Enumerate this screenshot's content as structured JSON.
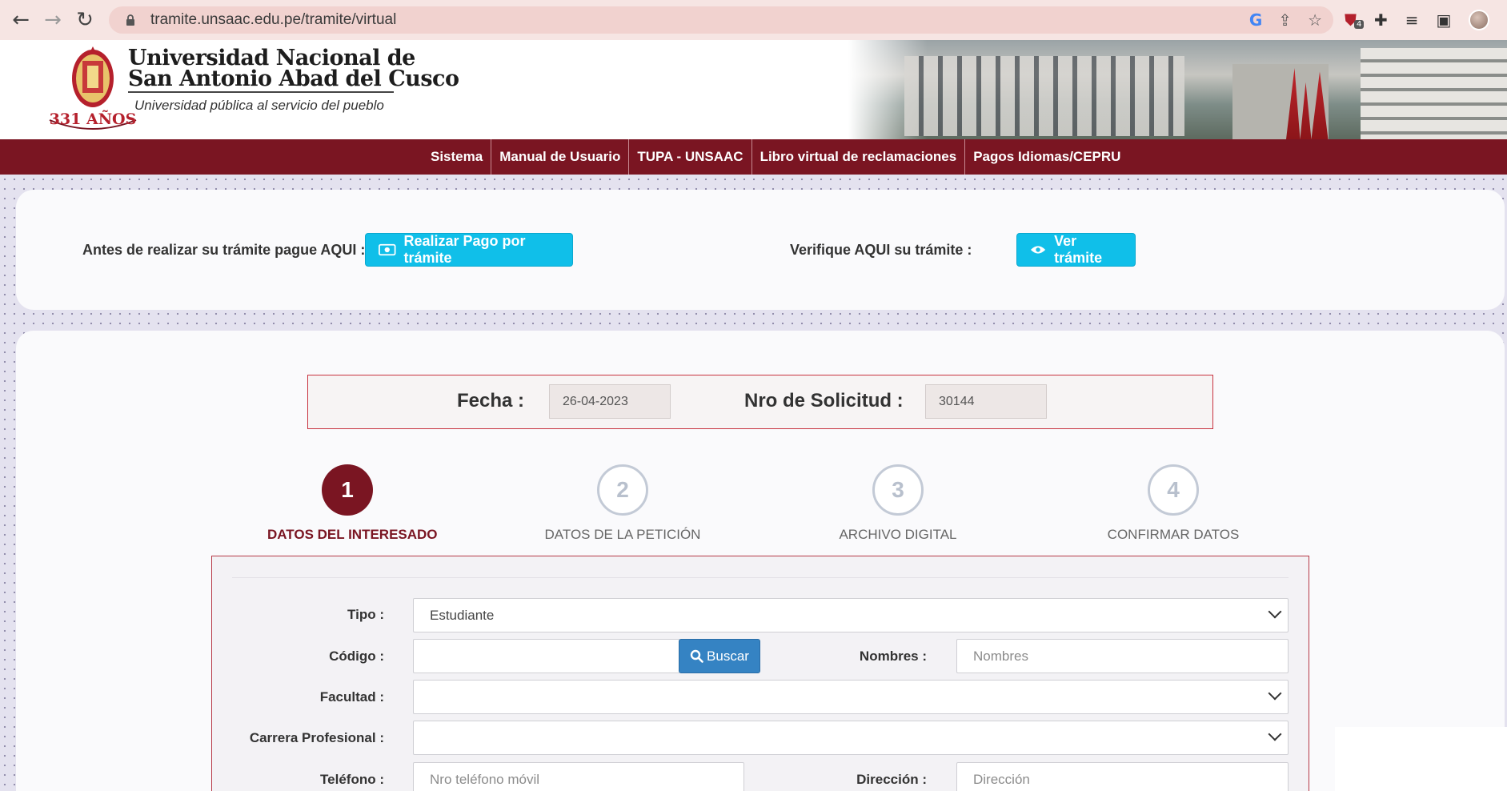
{
  "browser": {
    "url": "tramite.unsaac.edu.pe/tramite/virtual",
    "ext_badge": "4"
  },
  "header": {
    "uni_name_line1": "Universidad Nacional de",
    "uni_name_line2": "San Antonio Abad del Cusco",
    "tagline": "Universidad pública al servicio del pueblo",
    "crest_years": "331 AÑOS"
  },
  "nav": {
    "items": [
      "Sistema",
      "Manual de Usuario",
      "TUPA - UNSAAC",
      "Libro virtual de reclamaciones",
      "Pagos Idiomas/CEPRU"
    ]
  },
  "payment": {
    "pay_label": "Antes de realizar su trámite pague AQUI :",
    "pay_button": "Realizar Pago por trámite",
    "verify_label": "Verifique AQUI su trámite :",
    "verify_button": "Ver trámite"
  },
  "request": {
    "date_label": "Fecha :",
    "date_value": "26-04-2023",
    "number_label": "Nro de Solicitud :",
    "number_value": "30144"
  },
  "steps": [
    {
      "num": "1",
      "label": "DATOS DEL INTERESADO"
    },
    {
      "num": "2",
      "label": "DATOS DE LA PETICIÓN"
    },
    {
      "num": "3",
      "label": "ARCHIVO DIGITAL"
    },
    {
      "num": "4",
      "label": "CONFIRMAR DATOS"
    }
  ],
  "form": {
    "tipo_label": "Tipo :",
    "tipo_value": "Estudiante",
    "codigo_label": "Código :",
    "codigo_value": "",
    "buscar_button": "Buscar",
    "nombres_label": "Nombres :",
    "nombres_placeholder": "Nombres",
    "facultad_label": "Facultad :",
    "facultad_value": "",
    "carrera_label": "Carrera Profesional :",
    "carrera_value": "",
    "telefono_label": "Teléfono :",
    "telefono_placeholder": "Nro teléfono móvil",
    "direccion_label": "Dirección :",
    "direccion_placeholder": "Dirección"
  },
  "colors": {
    "brand": "#7a1522",
    "cyan_button": "#10bfe9",
    "buscar_button": "#3583c3"
  }
}
